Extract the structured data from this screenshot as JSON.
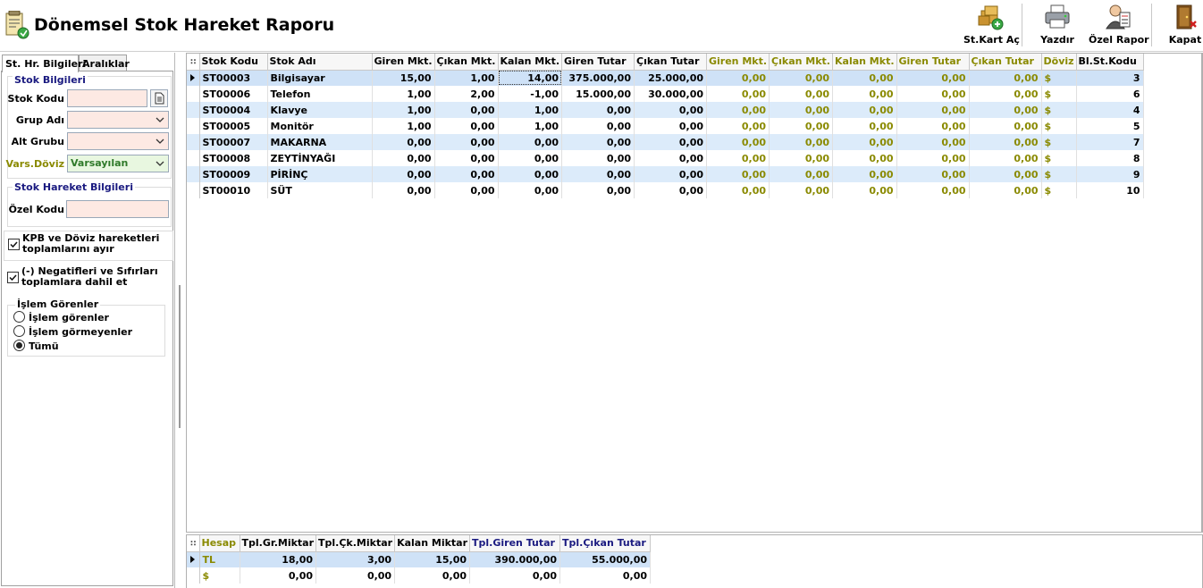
{
  "header": {
    "title": "Dönemsel Stok Hareket Raporu",
    "buttons": [
      {
        "label": "St.Kart Aç",
        "icon": "open-stock-card-icon"
      },
      {
        "label": "Yazdır",
        "icon": "printer-icon"
      },
      {
        "label": "Özel Rapor",
        "icon": "custom-report-icon"
      },
      {
        "label": "Kapat",
        "icon": "close-door-icon"
      }
    ]
  },
  "left_panel": {
    "tabs": [
      "St. Hr. Bilgileri",
      "Aralıklar"
    ],
    "stok_bilgileri": {
      "title": "Stok Bilgileri",
      "stok_kodu_label": "Stok Kodu",
      "stok_kodu_value": "",
      "grup_adi_label": "Grup Adı",
      "grup_adi_value": "",
      "alt_grubu_label": "Alt Grubu",
      "alt_grubu_value": "",
      "vars_doviz_label": "Vars.Döviz",
      "vars_doviz_value": "Varsayılan"
    },
    "stok_hareket": {
      "title": "Stok Hareket Bilgileri",
      "ozel_kodu_label": "Özel Kodu",
      "ozel_kodu_value": ""
    },
    "checkboxes": [
      {
        "label": "KPB ve Döviz hareketleri toplamlarını ayır",
        "checked": true
      },
      {
        "label": "(-) Negatifleri ve Sıfırları toplamlara dahil et",
        "checked": true
      }
    ],
    "islem_gorenler": {
      "title": "İşlem Görenler",
      "options": [
        "İşlem görenler",
        "İşlem görmeyenler",
        "Tümü"
      ],
      "selected": "Tümü"
    }
  },
  "main_grid": {
    "columns": [
      "Stok Kodu",
      "Stok Adı",
      "Giren Mkt.",
      "Çıkan Mkt.",
      "Kalan Mkt.",
      "Giren Tutar",
      "Çıkan Tutar",
      "Giren Mkt.",
      "Çıkan Mkt.",
      "Kalan Mkt.",
      "Giren Tutar",
      "Çıkan Tutar",
      "Döviz",
      "Bl.St.Kodu"
    ],
    "rows": [
      [
        "ST00003",
        "Bilgisayar",
        "15,00",
        "1,00",
        "14,00",
        "375.000,00",
        "25.000,00",
        "0,00",
        "0,00",
        "0,00",
        "0,00",
        "0,00",
        "$",
        "3"
      ],
      [
        "ST00006",
        "Telefon",
        "1,00",
        "2,00",
        "-1,00",
        "15.000,00",
        "30.000,00",
        "0,00",
        "0,00",
        "0,00",
        "0,00",
        "0,00",
        "$",
        "6"
      ],
      [
        "ST00004",
        "Klavye",
        "1,00",
        "0,00",
        "1,00",
        "0,00",
        "0,00",
        "0,00",
        "0,00",
        "0,00",
        "0,00",
        "0,00",
        "$",
        "4"
      ],
      [
        "ST00005",
        "Monitör",
        "1,00",
        "0,00",
        "1,00",
        "0,00",
        "0,00",
        "0,00",
        "0,00",
        "0,00",
        "0,00",
        "0,00",
        "$",
        "5"
      ],
      [
        "ST00007",
        "MAKARNA",
        "0,00",
        "0,00",
        "0,00",
        "0,00",
        "0,00",
        "0,00",
        "0,00",
        "0,00",
        "0,00",
        "0,00",
        "$",
        "7"
      ],
      [
        "ST00008",
        "ZEYTİNYAĞI",
        "0,00",
        "0,00",
        "0,00",
        "0,00",
        "0,00",
        "0,00",
        "0,00",
        "0,00",
        "0,00",
        "0,00",
        "$",
        "8"
      ],
      [
        "ST00009",
        "PİRİNÇ",
        "0,00",
        "0,00",
        "0,00",
        "0,00",
        "0,00",
        "0,00",
        "0,00",
        "0,00",
        "0,00",
        "0,00",
        "$",
        "9"
      ],
      [
        "ST00010",
        "SÜT",
        "0,00",
        "0,00",
        "0,00",
        "0,00",
        "0,00",
        "0,00",
        "0,00",
        "0,00",
        "0,00",
        "0,00",
        "$",
        "10"
      ]
    ]
  },
  "summary_grid": {
    "columns": [
      "Hesap",
      "Tpl.Gr.Miktar",
      "Tpl.Çk.Miktar",
      "Kalan Miktar",
      "Tpl.Giren Tutar",
      "Tpl.Çıkan Tutar"
    ],
    "rows": [
      [
        "TL",
        "18,00",
        "3,00",
        "15,00",
        "390.000,00",
        "55.000,00"
      ],
      [
        "$",
        "0,00",
        "0,00",
        "0,00",
        "0,00",
        "0,00"
      ]
    ]
  },
  "colors": {
    "row_alt": "#dcebfa",
    "input_bg": "#fde9e3",
    "olive": "#8a8a00",
    "navy": "#1a1a80"
  }
}
